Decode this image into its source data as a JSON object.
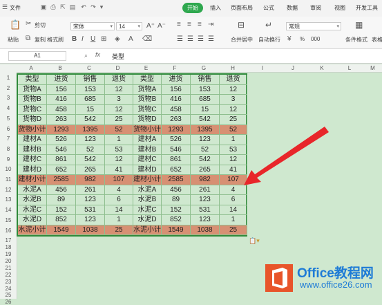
{
  "menubar": {
    "file": "文件",
    "tabs": [
      "开始",
      "插入",
      "页面布局",
      "公式",
      "数据",
      "审阅",
      "视图",
      "开发工具"
    ]
  },
  "ribbon": {
    "paste": "粘贴",
    "cut": "剪切",
    "copy": "复制",
    "format_painter": "格式刷",
    "font_name": "宋体",
    "font_size": "14",
    "merge_center": "合并居中",
    "wrap_text": "自动换行",
    "number_format": "常规",
    "conditional_format": "条件格式",
    "table_style": "表格",
    "percent": "%",
    "thousands": "000"
  },
  "formula_bar": {
    "name_box": "A1",
    "fx": "fx",
    "content": "类型"
  },
  "columns": [
    "A",
    "B",
    "C",
    "D",
    "E",
    "F",
    "G",
    "H",
    "I",
    "J",
    "K",
    "L",
    "M"
  ],
  "rows": [
    "1",
    "2",
    "3",
    "4",
    "5",
    "6",
    "7",
    "8",
    "9",
    "10",
    "11",
    "12",
    "13",
    "14",
    "15",
    "16",
    "17",
    "18",
    "19",
    "20",
    "21",
    "22",
    "23",
    "24",
    "25",
    "26"
  ],
  "table": {
    "header": [
      "类型",
      "进货",
      "销售",
      "退货",
      "类型",
      "进货",
      "销售",
      "退货"
    ],
    "rows": [
      [
        "货物A",
        "156",
        "153",
        "12",
        "货物A",
        "156",
        "153",
        "12"
      ],
      [
        "货物B",
        "416",
        "685",
        "3",
        "货物B",
        "416",
        "685",
        "3"
      ],
      [
        "货物C",
        "458",
        "15",
        "12",
        "货物C",
        "458",
        "15",
        "12"
      ],
      [
        "货物D",
        "263",
        "542",
        "25",
        "货物D",
        "263",
        "542",
        "25"
      ],
      [
        "货物小计",
        "1293",
        "1395",
        "52",
        "货物小计",
        "1293",
        "1395",
        "52"
      ],
      [
        "建材A",
        "526",
        "123",
        "1",
        "建材A",
        "526",
        "123",
        "1"
      ],
      [
        "建材B",
        "546",
        "52",
        "53",
        "建材B",
        "546",
        "52",
        "53"
      ],
      [
        "建材C",
        "861",
        "542",
        "12",
        "建材C",
        "861",
        "542",
        "12"
      ],
      [
        "建材D",
        "652",
        "265",
        "41",
        "建材D",
        "652",
        "265",
        "41"
      ],
      [
        "建材小计",
        "2585",
        "982",
        "107",
        "建材小计",
        "2585",
        "982",
        "107"
      ],
      [
        "水泥A",
        "456",
        "261",
        "4",
        "水泥A",
        "456",
        "261",
        "4"
      ],
      [
        "水泥B",
        "89",
        "123",
        "6",
        "水泥B",
        "89",
        "123",
        "6"
      ],
      [
        "水泥C",
        "152",
        "531",
        "14",
        "水泥C",
        "152",
        "531",
        "14"
      ],
      [
        "水泥D",
        "852",
        "123",
        "1",
        "水泥D",
        "852",
        "123",
        "1"
      ],
      [
        "水泥小计",
        "1549",
        "1038",
        "25",
        "水泥小计",
        "1549",
        "1038",
        "25"
      ]
    ],
    "subtotal_rows": [
      4,
      9,
      14
    ]
  },
  "logo": {
    "line1": "Office教程网",
    "line2": "www.office26.com"
  },
  "colors": {
    "accent": "#2fa84f",
    "subtotal_fill": "#d79073",
    "sheet_bg": "#cfe8cf",
    "arrow": "#e8262a"
  }
}
